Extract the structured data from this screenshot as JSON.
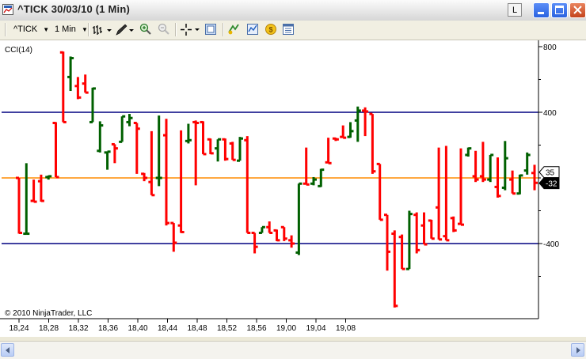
{
  "window": {
    "title": "^TICK  30/03/10 (1 Min)",
    "l_button": "L"
  },
  "toolbar": {
    "instrument": "^TICK",
    "interval": "1 Min",
    "icons": [
      "bar-type-icon",
      "draw-pencil-icon",
      "zoom-in-icon",
      "zoom-out-icon",
      "crosshair-icon",
      "properties-icon",
      "strategies-icon",
      "indicators-icon",
      "coin-icon",
      "data-box-icon"
    ]
  },
  "chart": {
    "indicator_label": "CCI(14)",
    "copyright": "© 2010 NinjaTrader, LLC",
    "colors": {
      "up": "#006000",
      "down": "#ff0000",
      "zero_line": "#ff8c00",
      "bands": "#000080"
    },
    "y_axis": {
      "ticks": [
        "800",
        "400",
        "-400"
      ],
      "min": -800,
      "max": 800
    },
    "x_axis": {
      "ticks": [
        "18,24",
        "18,28",
        "18,32",
        "18,36",
        "18,40",
        "18,44",
        "18,48",
        "18,52",
        "18,56",
        "19,00",
        "19,04",
        "19,08"
      ]
    },
    "markers": [
      {
        "label": "35",
        "value": 35,
        "style": "outline"
      },
      {
        "label": "-32",
        "value": -32,
        "style": "filled"
      }
    ]
  },
  "chart_data": {
    "type": "ohlc",
    "title": "CCI(14)",
    "y_range": [
      -800,
      800
    ],
    "reference_lines": [
      400,
      0,
      -400
    ],
    "bars": [
      {
        "o": 0,
        "h": -5,
        "l": -340,
        "c": -335
      },
      {
        "o": -340,
        "h": 90,
        "l": -345,
        "c": -340
      },
      {
        "o": -140,
        "h": -10,
        "l": -145,
        "c": -145
      },
      {
        "o": -20,
        "h": 20,
        "l": -145,
        "c": -140
      },
      {
        "o": 5,
        "h": 15,
        "l": -10,
        "c": 10
      },
      {
        "o": 335,
        "h": 340,
        "l": 15,
        "c": 5
      },
      {
        "o": 765,
        "h": 770,
        "l": 345,
        "c": 340
      },
      {
        "o": 615,
        "h": 740,
        "l": 530,
        "c": 730
      },
      {
        "o": 560,
        "h": 615,
        "l": 480,
        "c": 490
      },
      {
        "o": 575,
        "h": 630,
        "l": 520,
        "c": 520
      },
      {
        "o": 340,
        "h": 550,
        "l": 340,
        "c": 545
      },
      {
        "o": 165,
        "h": 345,
        "l": 155,
        "c": 320
      },
      {
        "o": 155,
        "h": 160,
        "l": 50,
        "c": 160
      },
      {
        "o": 205,
        "h": 205,
        "l": 90,
        "c": 180
      },
      {
        "o": 220,
        "h": 375,
        "l": 220,
        "c": 375
      },
      {
        "o": 340,
        "h": 390,
        "l": 315,
        "c": 365
      },
      {
        "o": 335,
        "h": 335,
        "l": 25,
        "c": 300
      },
      {
        "o": 25,
        "h": 30,
        "l": -20,
        "c": 0
      },
      {
        "o": -25,
        "h": 285,
        "l": -105,
        "c": -105
      },
      {
        "o": 0,
        "h": 380,
        "l": -50,
        "c": 0
      },
      {
        "o": 260,
        "h": 360,
        "l": -290,
        "c": -275
      },
      {
        "o": -275,
        "h": -280,
        "l": -450,
        "c": -395
      },
      {
        "o": -290,
        "h": 290,
        "l": -335,
        "c": -330
      },
      {
        "o": 225,
        "h": 330,
        "l": 210,
        "c": 230
      },
      {
        "o": 340,
        "h": 350,
        "l": -45,
        "c": 335
      },
      {
        "o": 340,
        "h": 345,
        "l": 145,
        "c": 145
      },
      {
        "o": 235,
        "h": 240,
        "l": 145,
        "c": 150
      },
      {
        "o": 180,
        "h": 235,
        "l": 100,
        "c": 235
      },
      {
        "o": 235,
        "h": 240,
        "l": 105,
        "c": 115
      },
      {
        "o": 210,
        "h": 220,
        "l": 115,
        "c": 110
      },
      {
        "o": 105,
        "h": 250,
        "l": 110,
        "c": 240
      },
      {
        "o": 230,
        "h": 255,
        "l": -335,
        "c": -335
      },
      {
        "o": -335,
        "h": -340,
        "l": -460,
        "c": -420
      },
      {
        "o": -335,
        "h": -300,
        "l": -330,
        "c": -300
      },
      {
        "o": -300,
        "h": -265,
        "l": -330,
        "c": -335
      },
      {
        "o": -320,
        "h": -315,
        "l": -385,
        "c": -380
      },
      {
        "o": -300,
        "h": -330,
        "l": -385,
        "c": -370
      },
      {
        "o": -380,
        "h": -350,
        "l": -425,
        "c": -400
      },
      {
        "o": -455,
        "h": -35,
        "l": -470,
        "c": -35
      },
      {
        "o": -35,
        "h": 185,
        "l": -35,
        "c": -40
      },
      {
        "o": -35,
        "h": 5,
        "l": -45,
        "c": -10
      },
      {
        "o": -50,
        "h": 55,
        "l": -55,
        "c": 50
      },
      {
        "o": 95,
        "h": 245,
        "l": 95,
        "c": 90
      },
      {
        "o": 240,
        "h": 245,
        "l": 225,
        "c": 235
      },
      {
        "o": 250,
        "h": 320,
        "l": 245,
        "c": 245
      },
      {
        "o": 250,
        "h": 340,
        "l": 245,
        "c": 285
      },
      {
        "o": 350,
        "h": 435,
        "l": 220,
        "c": 410
      },
      {
        "o": 410,
        "h": 430,
        "l": 255,
        "c": 405
      },
      {
        "o": 390,
        "h": 190,
        "l": 25,
        "c": 40
      },
      {
        "o": 85,
        "h": 80,
        "l": -255,
        "c": -255
      },
      {
        "o": -225,
        "h": -275,
        "l": -565,
        "c": -450
      },
      {
        "o": -340,
        "h": -320,
        "l": -790,
        "c": -780
      },
      {
        "o": -360,
        "h": -345,
        "l": -550,
        "c": -555
      },
      {
        "o": -555,
        "h": -200,
        "l": -555,
        "c": -220
      },
      {
        "o": -225,
        "h": -210,
        "l": -460,
        "c": -440
      },
      {
        "o": -290,
        "h": -210,
        "l": -405,
        "c": -405
      },
      {
        "o": -260,
        "h": -255,
        "l": -365,
        "c": -370
      },
      {
        "o": -180,
        "h": 185,
        "l": -370,
        "c": -375
      },
      {
        "o": -355,
        "h": 195,
        "l": -365,
        "c": -380
      },
      {
        "o": -245,
        "h": -235,
        "l": -330,
        "c": -320
      },
      {
        "o": -280,
        "h": 180,
        "l": -280,
        "c": -285
      },
      {
        "o": 140,
        "h": 185,
        "l": 130,
        "c": 180
      },
      {
        "o": 10,
        "h": 165,
        "l": -25,
        "c": -10
      },
      {
        "o": 10,
        "h": 220,
        "l": -25,
        "c": -10
      },
      {
        "o": -10,
        "h": 140,
        "l": -25,
        "c": 140
      },
      {
        "o": -55,
        "h": 125,
        "l": -120,
        "c": -110
      },
      {
        "o": -60,
        "h": 225,
        "l": -75,
        "c": 120
      },
      {
        "o": -10,
        "h": 45,
        "l": -95,
        "c": -95
      },
      {
        "o": -95,
        "h": 20,
        "l": -100,
        "c": 15
      },
      {
        "o": 45,
        "h": 155,
        "l": 20,
        "c": 140
      },
      {
        "o": 30,
        "h": 80,
        "l": -75,
        "c": -30
      }
    ]
  }
}
